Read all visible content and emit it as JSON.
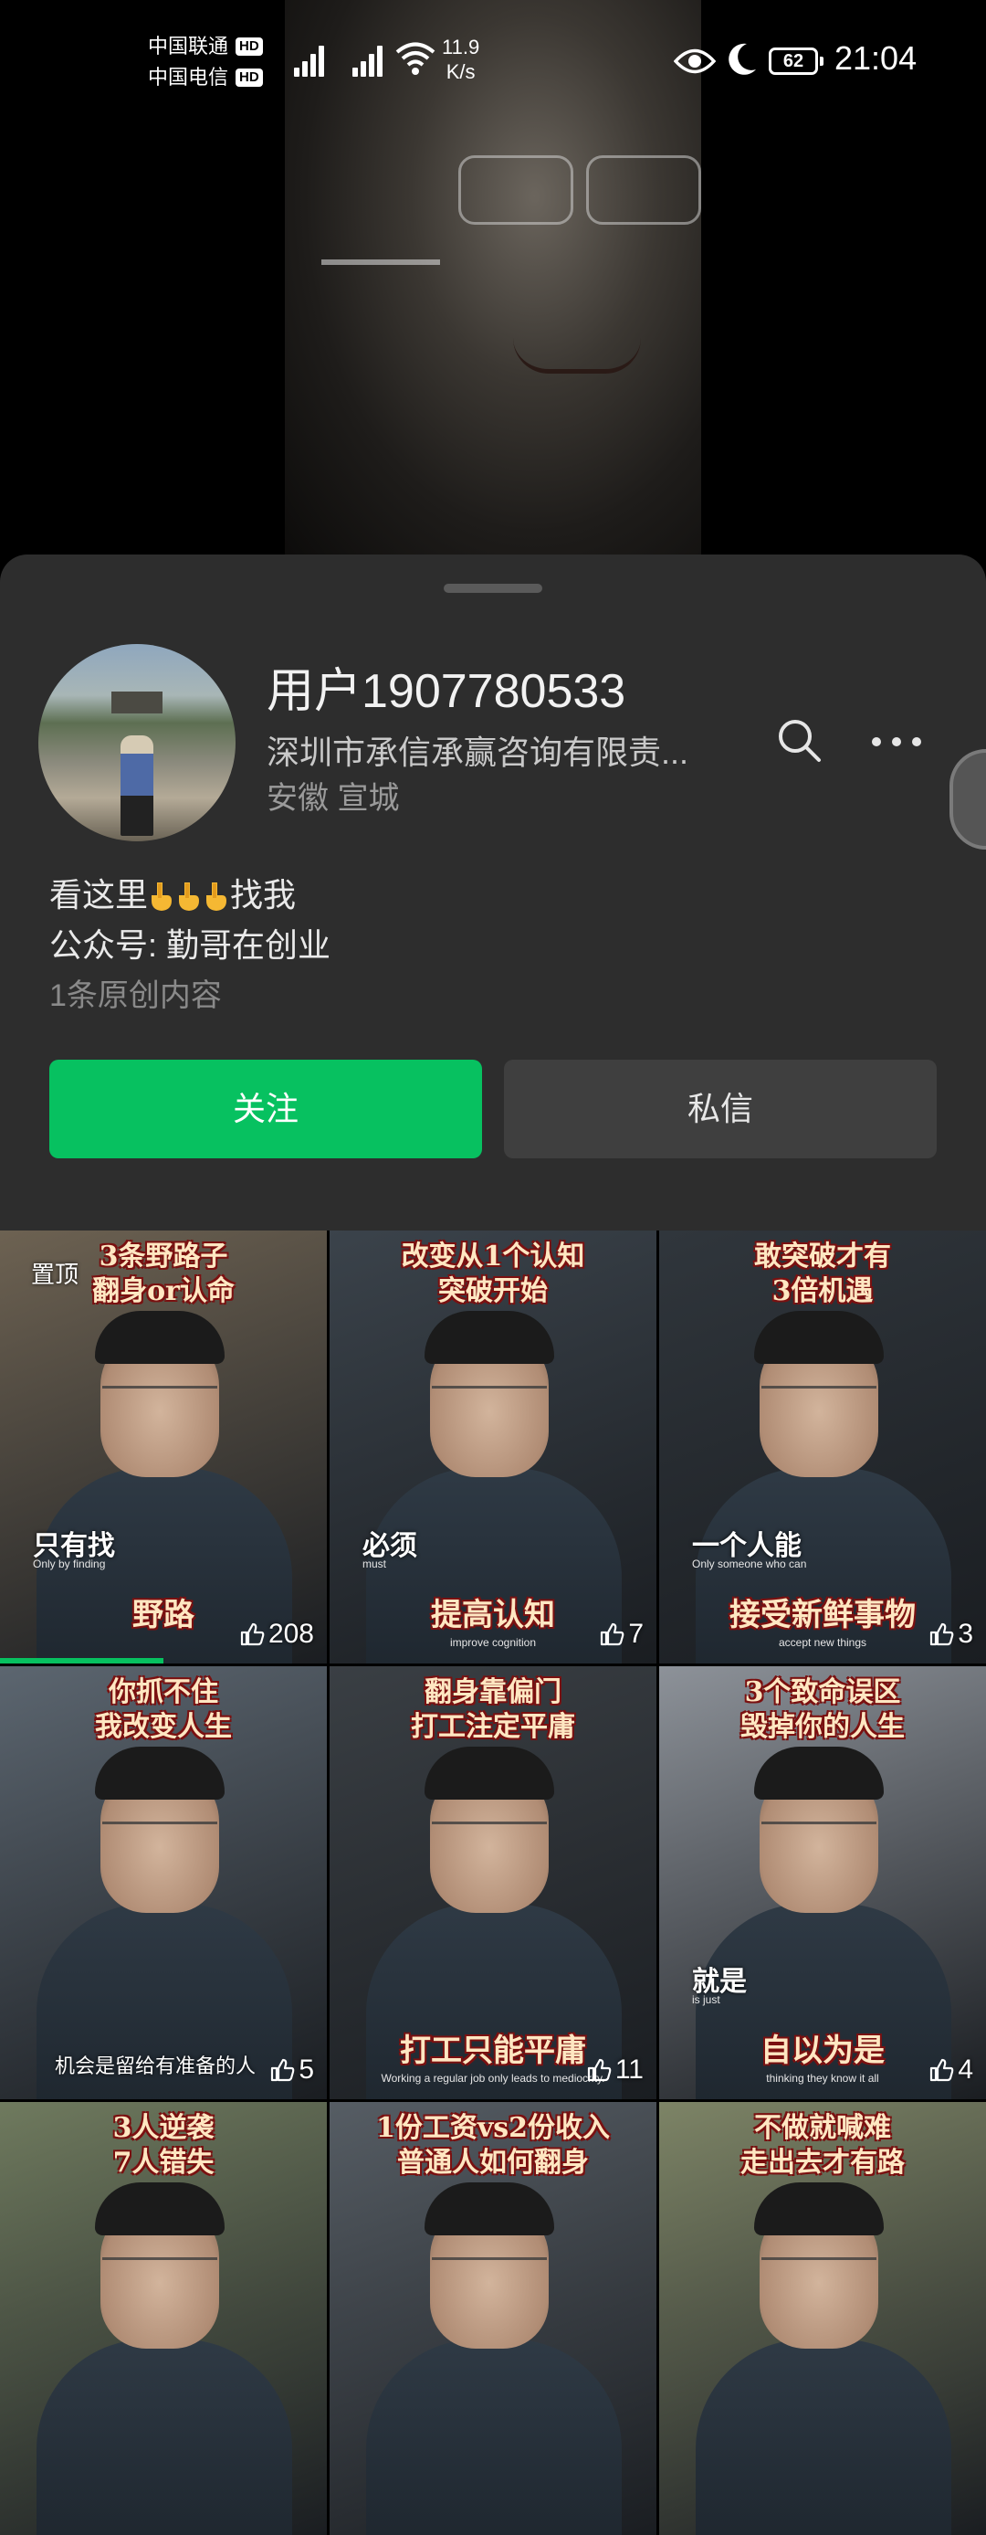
{
  "status_bar": {
    "carrier_1": "中国联通",
    "carrier_2": "中国电信",
    "hd_badge": "HD",
    "net_speed_value": "11.9",
    "net_speed_unit": "K/s",
    "battery": "62",
    "time": "21:04"
  },
  "profile": {
    "name": "用户1907780533",
    "company": "深圳市承信承赢咨询有限责...",
    "location": "安徽 宣城",
    "bio_line1_before": "看这里",
    "bio_line1_after": "找我",
    "bio_line2": "公众号: 勤哥在创业",
    "original_count": "1条原创内容",
    "follow_label": "关注",
    "message_label": "私信",
    "icons": [
      "search-icon",
      "more-icon"
    ]
  },
  "videos": [
    {
      "pinned": "置顶",
      "top_line1": "3条野路子",
      "top_line2": "翻身or认命",
      "sub": "只有找",
      "sub_en": "Only by finding",
      "bottom": "野路",
      "likes": "208",
      "bg": "#6d6252",
      "progress": 0.5
    },
    {
      "top_line1": "改变从1个认知",
      "top_line2": "突破开始",
      "sub": "必须",
      "sub_en": "must",
      "bottom": "提高认知",
      "bottom_en": "improve cognition",
      "likes": "7",
      "bg": "#3b434b"
    },
    {
      "top_line1": "敢突破才有",
      "top_line2": "3倍机遇",
      "sub": "一个人能",
      "sub_en": "Only someone who can",
      "bottom": "接受新鲜事物",
      "bottom_en": "accept new things",
      "likes": "3",
      "bg": "#30363c"
    },
    {
      "top_line1": "你抓不住",
      "top_line2": "我改变人生",
      "bottom_text": "机会是留给有准备的人",
      "likes": "5",
      "bg": "#5c6670"
    },
    {
      "top_line1": "翻身靠偏门",
      "top_line2": "打工注定平庸",
      "bottom": "打工只能平庸",
      "bottom_en": "Working a regular job only leads to mediocrity.",
      "likes": "11",
      "bg": "#3a3f44"
    },
    {
      "top_line1": "3个致命误区",
      "top_line2": "毁掉你的人生",
      "sub": "就是",
      "sub_en": "is just",
      "bottom": "自以为是",
      "bottom_en": "thinking they know it all",
      "likes": "4",
      "bg": "#8d9299"
    },
    {
      "top_line1": "3人逆袭",
      "top_line2": "7人错失",
      "bg": "#6f7a5e"
    },
    {
      "top_line1": "1份工资vs2份收入",
      "top_line2": "普通人如何翻身",
      "bg": "#565d64"
    },
    {
      "top_line1": "不做就喊难",
      "top_line2": "走出去才有路",
      "bg": "#7d8466"
    }
  ]
}
